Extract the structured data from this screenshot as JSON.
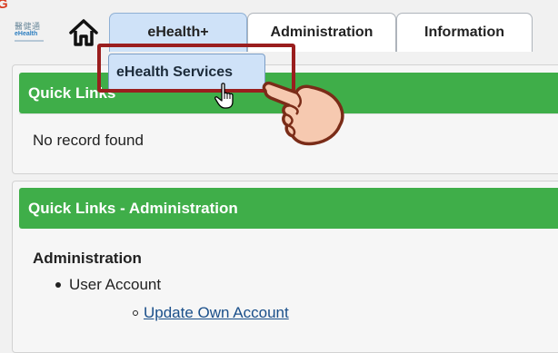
{
  "corner_glyph": "G",
  "logo": {
    "cn": "醫健通",
    "en": "eHealth"
  },
  "tabs": [
    {
      "label": "eHealth+"
    },
    {
      "label": "Administration"
    },
    {
      "label": "Information"
    }
  ],
  "dropdown": {
    "item": "eHealth Services"
  },
  "panel1": {
    "heading": "Quick Links",
    "empty_text": "No record found"
  },
  "panel2": {
    "heading": "Quick Links - Administration",
    "section": "Administration",
    "item": "User Account",
    "link": "Update Own Account"
  },
  "colors": {
    "header_green": "#3fae49",
    "tab_active": "#cfe2f8",
    "highlight_red": "#9a1e1e",
    "link": "#1a4f8a"
  },
  "icons": [
    "home-icon",
    "pointer-cursor-icon",
    "pointing-hand-icon"
  ]
}
